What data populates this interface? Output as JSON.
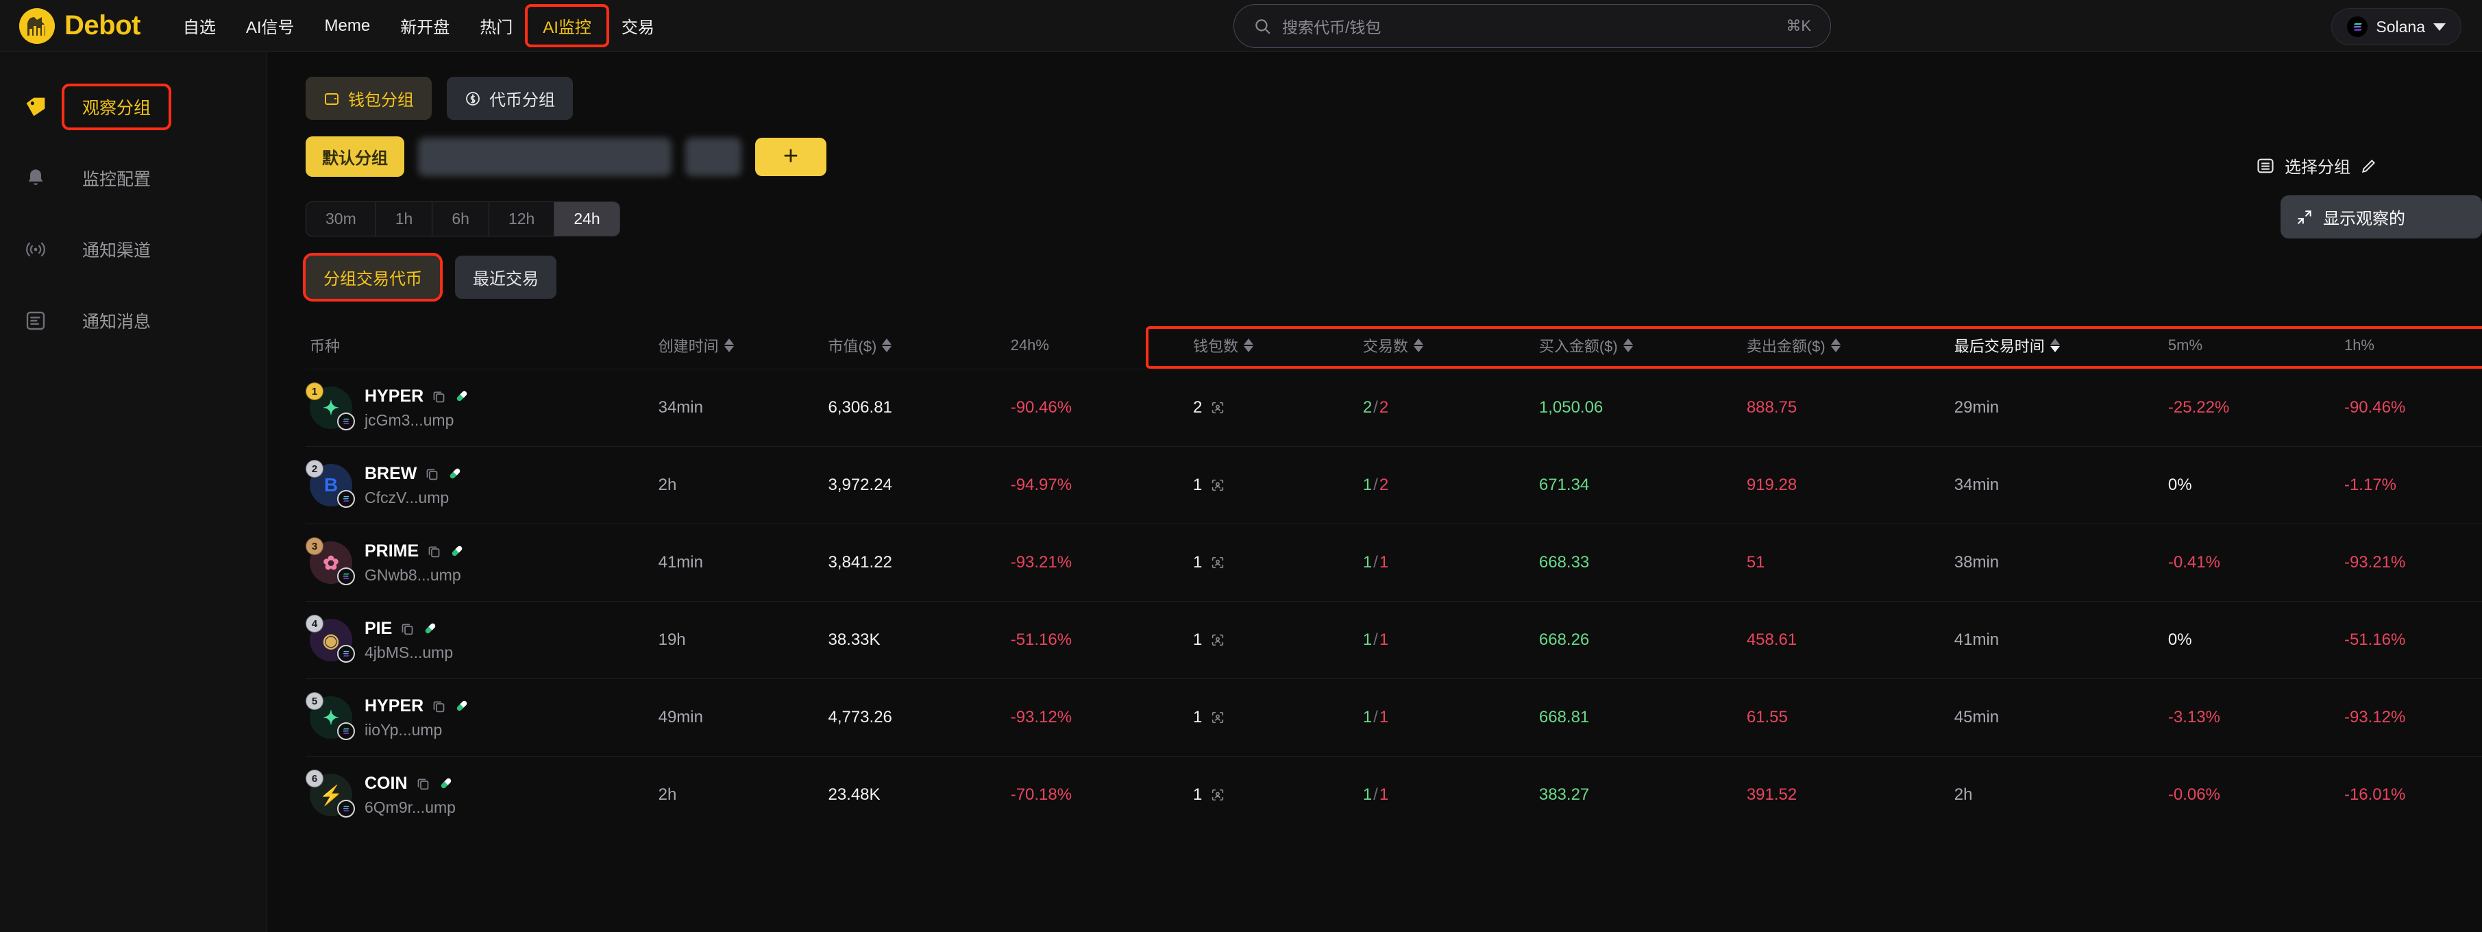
{
  "header": {
    "brand": "Debot",
    "nav": [
      {
        "label": "自选",
        "active": false
      },
      {
        "label": "AI信号",
        "active": false
      },
      {
        "label": "Meme",
        "active": false
      },
      {
        "label": "新开盘",
        "active": false
      },
      {
        "label": "热门",
        "active": false
      },
      {
        "label": "AI监控",
        "active": true
      },
      {
        "label": "交易",
        "active": false
      }
    ],
    "search": {
      "placeholder": "搜索代币/钱包",
      "shortcut": "⌘K"
    },
    "chain": {
      "name": "Solana"
    }
  },
  "sidebar": {
    "items": [
      {
        "label": "观察分组",
        "icon": "tag-icon",
        "active": true
      },
      {
        "label": "监控配置",
        "icon": "bell-icon",
        "active": false
      },
      {
        "label": "通知渠道",
        "icon": "broadcast-icon",
        "active": false
      },
      {
        "label": "通知消息",
        "icon": "list-icon",
        "active": false
      }
    ]
  },
  "main": {
    "group_tabs": [
      {
        "label": "钱包分组",
        "icon": "wallet-icon",
        "active": true
      },
      {
        "label": "代币分组",
        "icon": "dollar-circle-icon",
        "active": false
      }
    ],
    "group_chips": {
      "default_label": "默认分组",
      "add_label": "+"
    },
    "time_filters": [
      {
        "label": "30m",
        "active": false
      },
      {
        "label": "1h",
        "active": false
      },
      {
        "label": "6h",
        "active": false
      },
      {
        "label": "12h",
        "active": false
      },
      {
        "label": "24h",
        "active": true
      }
    ],
    "sub_tabs": [
      {
        "label": "分组交易代币",
        "active": true
      },
      {
        "label": "最近交易",
        "active": false
      }
    ],
    "actions": {
      "select_group": "选择分组",
      "show_watch": "显示观察的"
    }
  },
  "table": {
    "columns": [
      {
        "label": "币种",
        "sortable": false,
        "sorted": false
      },
      {
        "label": "创建时间",
        "sortable": true,
        "sorted": false
      },
      {
        "label": "市值($)",
        "sortable": true,
        "sorted": false
      },
      {
        "label": "24h%",
        "sortable": false,
        "sorted": false
      },
      {
        "label": "钱包数",
        "sortable": true,
        "sorted": false
      },
      {
        "label": "交易数",
        "sortable": true,
        "sorted": false
      },
      {
        "label": "买入金额($)",
        "sortable": true,
        "sorted": false
      },
      {
        "label": "卖出金额($)",
        "sortable": true,
        "sorted": false
      },
      {
        "label": "最后交易时间",
        "sortable": true,
        "sorted": true
      },
      {
        "label": "5m%",
        "sortable": false,
        "sorted": false
      },
      {
        "label": "1h%",
        "sortable": false,
        "sorted": false
      }
    ],
    "rows": [
      {
        "rank": "1",
        "symbol": "HYPER",
        "address": "jcGm3...ump",
        "created": "34min",
        "marketcap": "6,306.81",
        "change_24h": "-90.46%",
        "wallets": "2",
        "tx_buy": "2",
        "tx_sell": "2",
        "buy_amount": "1,050.06",
        "sell_amount": "888.75",
        "last_trade": "29min",
        "change_5m": "-25.22%",
        "change_1h": "-90.46%"
      },
      {
        "rank": "2",
        "symbol": "BREW",
        "address": "CfczV...ump",
        "created": "2h",
        "marketcap": "3,972.24",
        "change_24h": "-94.97%",
        "wallets": "1",
        "tx_buy": "1",
        "tx_sell": "2",
        "buy_amount": "671.34",
        "sell_amount": "919.28",
        "last_trade": "34min",
        "change_5m": "0%",
        "change_1h": "-1.17%"
      },
      {
        "rank": "3",
        "symbol": "PRIME",
        "address": "GNwb8...ump",
        "created": "41min",
        "marketcap": "3,841.22",
        "change_24h": "-93.21%",
        "wallets": "1",
        "tx_buy": "1",
        "tx_sell": "1",
        "buy_amount": "668.33",
        "sell_amount": "51",
        "last_trade": "38min",
        "change_5m": "-0.41%",
        "change_1h": "-93.21%"
      },
      {
        "rank": "4",
        "symbol": "PIE",
        "address": "4jbMS...ump",
        "created": "19h",
        "marketcap": "38.33K",
        "change_24h": "-51.16%",
        "wallets": "1",
        "tx_buy": "1",
        "tx_sell": "1",
        "buy_amount": "668.26",
        "sell_amount": "458.61",
        "last_trade": "41min",
        "change_5m": "0%",
        "change_1h": "-51.16%"
      },
      {
        "rank": "5",
        "symbol": "HYPER",
        "address": "iioYp...ump",
        "created": "49min",
        "marketcap": "4,773.26",
        "change_24h": "-93.12%",
        "wallets": "1",
        "tx_buy": "1",
        "tx_sell": "1",
        "buy_amount": "668.81",
        "sell_amount": "61.55",
        "last_trade": "45min",
        "change_5m": "-3.13%",
        "change_1h": "-93.12%"
      },
      {
        "rank": "6",
        "symbol": "COIN",
        "address": "6Qm9r...ump",
        "created": "2h",
        "marketcap": "23.48K",
        "change_24h": "-70.18%",
        "wallets": "1",
        "tx_buy": "1",
        "tx_sell": "1",
        "buy_amount": "383.27",
        "sell_amount": "391.52",
        "last_trade": "2h",
        "change_5m": "-0.06%",
        "change_1h": "-16.01%"
      }
    ]
  },
  "colors": {
    "accent": "#f5c518",
    "up": "#69d98a",
    "down": "#e8455f",
    "highlight_box": "#ff2d16",
    "background": "#0d0d0d"
  }
}
